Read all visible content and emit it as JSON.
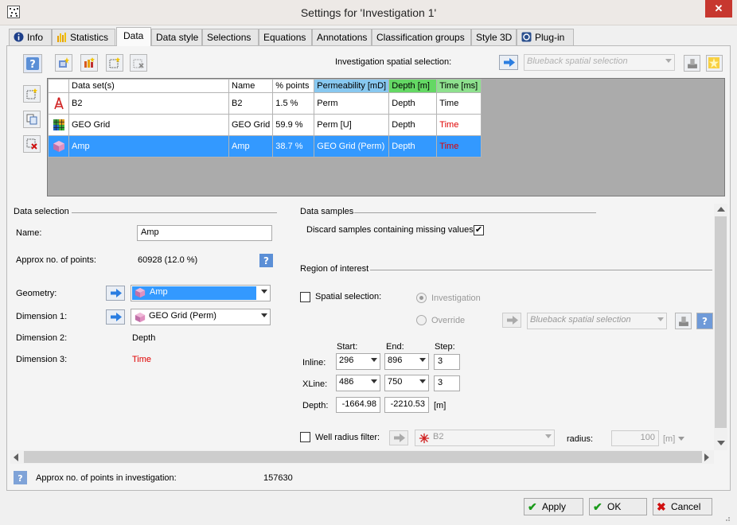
{
  "window": {
    "title": "Settings for 'Investigation 1'",
    "close": "✕"
  },
  "tabs": [
    "Info",
    "Statistics",
    "Data",
    "Data style",
    "Selections",
    "Equations",
    "Annotations",
    "Classification groups",
    "Style 3D",
    "Plug-in"
  ],
  "toolbar": {
    "spatial_label": "Investigation spatial selection:",
    "spatial_placeholder": "Blueback spatial selection"
  },
  "grid": {
    "headers": [
      "Data set(s)",
      "Name",
      "% points",
      "Permeability [mD]",
      "Depth [m]",
      "Time [ms]"
    ],
    "rows": [
      {
        "icon": "well-icon",
        "dataset": "B2",
        "name": "B2",
        "points": "1.5 %",
        "x": "Perm",
        "y": "Depth",
        "z": "Time"
      },
      {
        "icon": "grid-icon",
        "dataset": "GEO Grid",
        "name": "GEO Grid",
        "points": "59.9 %",
        "x": "Perm [U]",
        "y": "Depth",
        "z": "Time"
      },
      {
        "icon": "cube-icon",
        "dataset": "Amp",
        "name": "Amp",
        "points": "38.7 %",
        "x": "GEO Grid (Perm)",
        "y": "Depth",
        "z": "Time"
      }
    ]
  },
  "data_selection": {
    "header": "Data selection",
    "name_label": "Name:",
    "name_value": "Amp",
    "approx_label": "Approx no. of points:",
    "approx_value": "60928 (12.0 %)",
    "geometry_label": "Geometry:",
    "geometry_value": "Amp",
    "dim1_label": "Dimension 1:",
    "dim1_value": "GEO Grid (Perm)",
    "dim2_label": "Dimension 2:",
    "dim2_value": "Depth",
    "dim3_label": "Dimension 3:",
    "dim3_value": "Time"
  },
  "data_samples": {
    "header": "Data samples",
    "discard_label": "Discard samples containing missing values:",
    "discard_checked": "✔"
  },
  "region": {
    "header": "Region of interest",
    "spatial_label": "Spatial selection:",
    "investigation_label": "Investigation",
    "override_label": "Override",
    "override_placeholder": "Blueback spatial selection",
    "start_label": "Start:",
    "end_label": "End:",
    "step_label": "Step:",
    "inline_label": "Inline:",
    "inline_start": "296",
    "inline_end": "896",
    "inline_step": "3",
    "xline_label": "XLine:",
    "xline_start": "486",
    "xline_end": "750",
    "xline_step": "3",
    "depth_label": "Depth:",
    "depth_start": "-1664.98",
    "depth_end": "-2210.53",
    "depth_unit": "[m]",
    "well_label": "Well radius filter:",
    "well_value": "B2",
    "radius_label": "radius:",
    "radius_value": "100",
    "radius_unit": "[m]"
  },
  "footer": {
    "approx_label": "Approx no. of points in investigation:",
    "approx_value": "157630"
  },
  "buttons": {
    "apply": "Apply",
    "ok": "OK",
    "cancel": "Cancel"
  },
  "colors": {
    "selection": "#3399ff",
    "perm_header": "#88c8f0",
    "depth_header": "#64d864",
    "time_text": "#e00000"
  }
}
